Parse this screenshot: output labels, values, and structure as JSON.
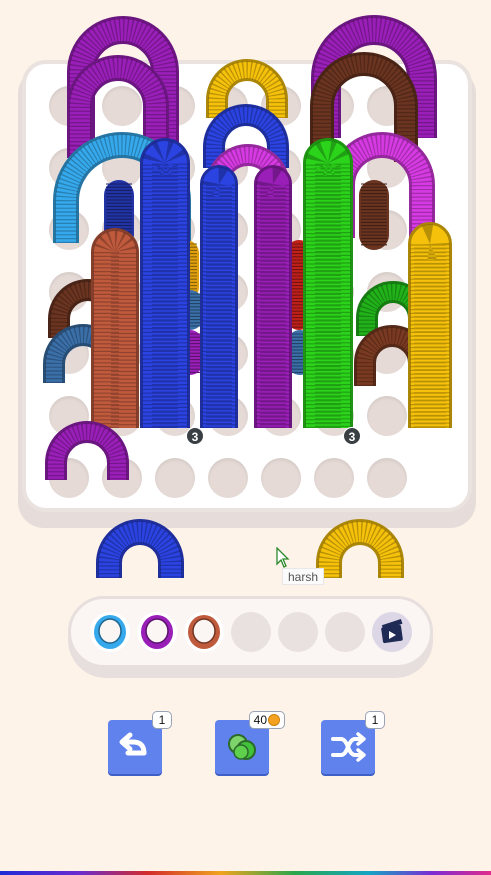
{
  "board": {
    "badge_left": "3",
    "badge_right": "3"
  },
  "floating_tooltip": "harsh",
  "tray": {
    "slots": [
      {
        "state": "filled",
        "color": "#36a9ec",
        "name": "light-blue-coil"
      },
      {
        "state": "filled",
        "color": "#9a1fb8",
        "name": "purple-coil"
      },
      {
        "state": "filled",
        "color": "#c05a3d",
        "name": "terracotta-coil"
      },
      {
        "state": "empty"
      },
      {
        "state": "empty"
      },
      {
        "state": "empty"
      },
      {
        "state": "locked",
        "icon": "clapperboard-icon"
      }
    ]
  },
  "powerups": {
    "undo": {
      "count": "1",
      "icon": "undo-arrow-icon"
    },
    "sort": {
      "cost": "40",
      "icon": "balls-icon",
      "currency_icon": "coin-icon"
    },
    "shuffle": {
      "count": "1",
      "icon": "shuffle-icon"
    }
  },
  "colors": {
    "blue": "#2b43e0",
    "purple": "#9a1fb8",
    "yellow": "#f5c10a",
    "brown": "#6a3420",
    "magenta": "#d63ae2",
    "green": "#2bd41a",
    "light_blue": "#36a9ec",
    "terracotta": "#c05a3d",
    "steel_blue": "#3a6fa8",
    "red": "#c0201a",
    "tray_button": "#5f82ec"
  }
}
